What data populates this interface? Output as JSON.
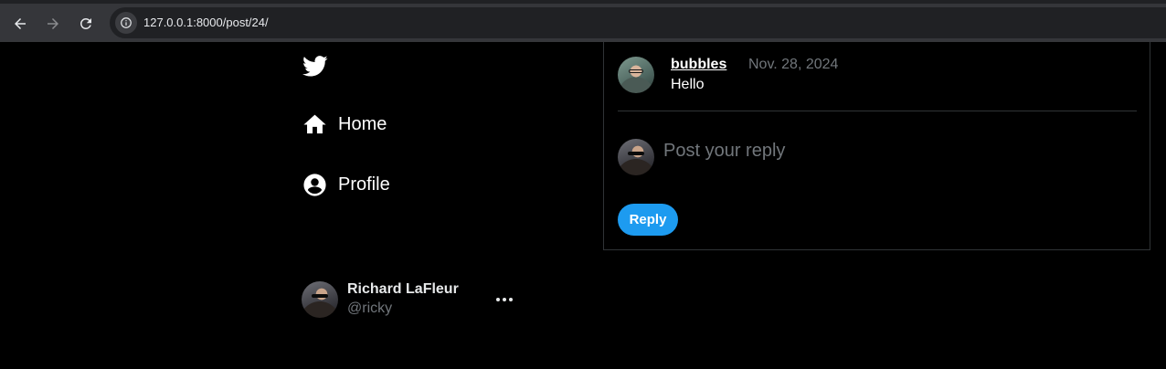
{
  "browser": {
    "url": "127.0.0.1:8000/post/24/",
    "back_icon": "arrow-left-icon",
    "forward_icon": "arrow-right-icon",
    "reload_icon": "reload-icon",
    "info_icon": "info-icon"
  },
  "sidebar": {
    "logo_icon": "twitter-bird-icon",
    "items": [
      {
        "label": "Home",
        "icon": "home-icon"
      },
      {
        "label": "Profile",
        "icon": "account-circle-icon"
      }
    ],
    "account": {
      "name": "Richard LaFleur",
      "handle": "@ricky",
      "more_icon": "more-horizontal-icon"
    }
  },
  "thread": {
    "comment": {
      "username": "bubbles",
      "date": "Nov. 28, 2024",
      "text": "Hello"
    },
    "reply": {
      "placeholder": "Post your reply",
      "button_label": "Reply"
    }
  },
  "colors": {
    "background": "#000000",
    "accent": "#1d9bf0",
    "muted_text": "#71767b",
    "border": "#2f3336"
  }
}
